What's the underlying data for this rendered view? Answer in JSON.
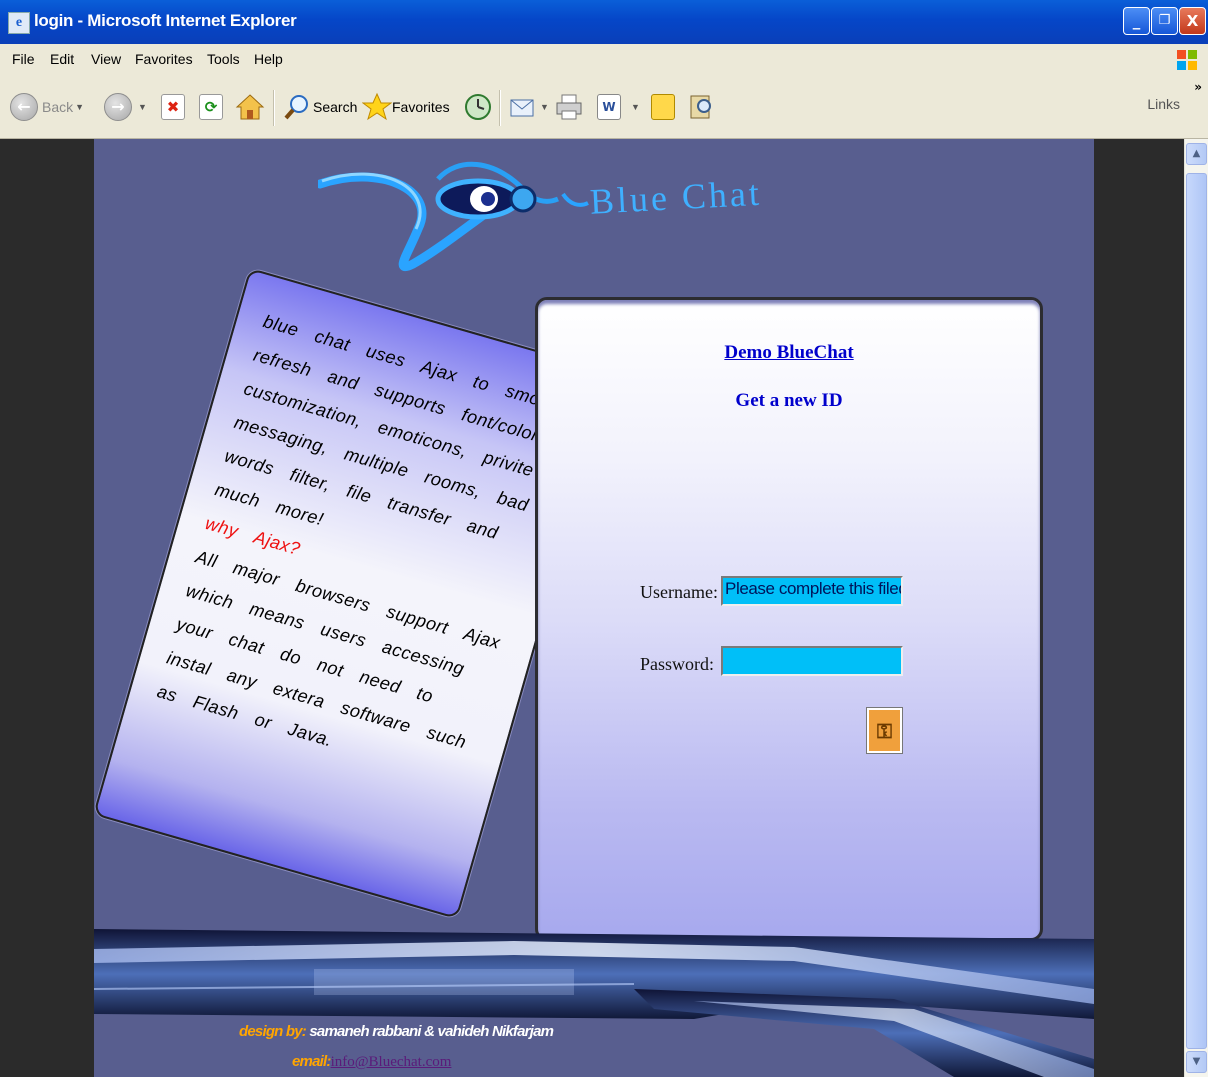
{
  "window": {
    "title": "login - Microsoft Internet Explorer",
    "controls": {
      "minimize": "_",
      "restore": "❐",
      "close": "X"
    }
  },
  "menu": [
    "File",
    "Edit",
    "View",
    "Favorites",
    "Tools",
    "Help"
  ],
  "toolbar": {
    "back": "Back",
    "search": "Search",
    "favorites": "Favorites",
    "links": "Links",
    "chevron": "»"
  },
  "site": {
    "logo_text": "Blue Chat",
    "info": {
      "paragraph": "blue chat uses Ajax to smooly refresh and supports font/color customization, emoticons, privite messaging, multiple rooms, bad words filter, file transfer and much more!",
      "heading": "why Ajax?",
      "paragraph2": "All major browsers support Ajax which means users accessing your chat do not need to instal any extera software such as Flash or Java."
    },
    "login": {
      "demo_link": "Demo BlueChat",
      "new_id_link": "Get a new ID",
      "username_label": "Username:",
      "username_value": "Please complete this filed",
      "password_label": "Password:",
      "password_value": ""
    },
    "footer": {
      "design_prefix": "design by:",
      "design_names": "samaneh rabbani & vahideh Nikfarjam",
      "email_prefix": "email:",
      "email": "info@Bluechat.com"
    }
  },
  "colors": {
    "page_bg": "#585e8f",
    "input_bg": "#00bff8",
    "link": "#0000cc",
    "why_ajax": "#ee1111",
    "footer_accent": "#ffa500"
  }
}
